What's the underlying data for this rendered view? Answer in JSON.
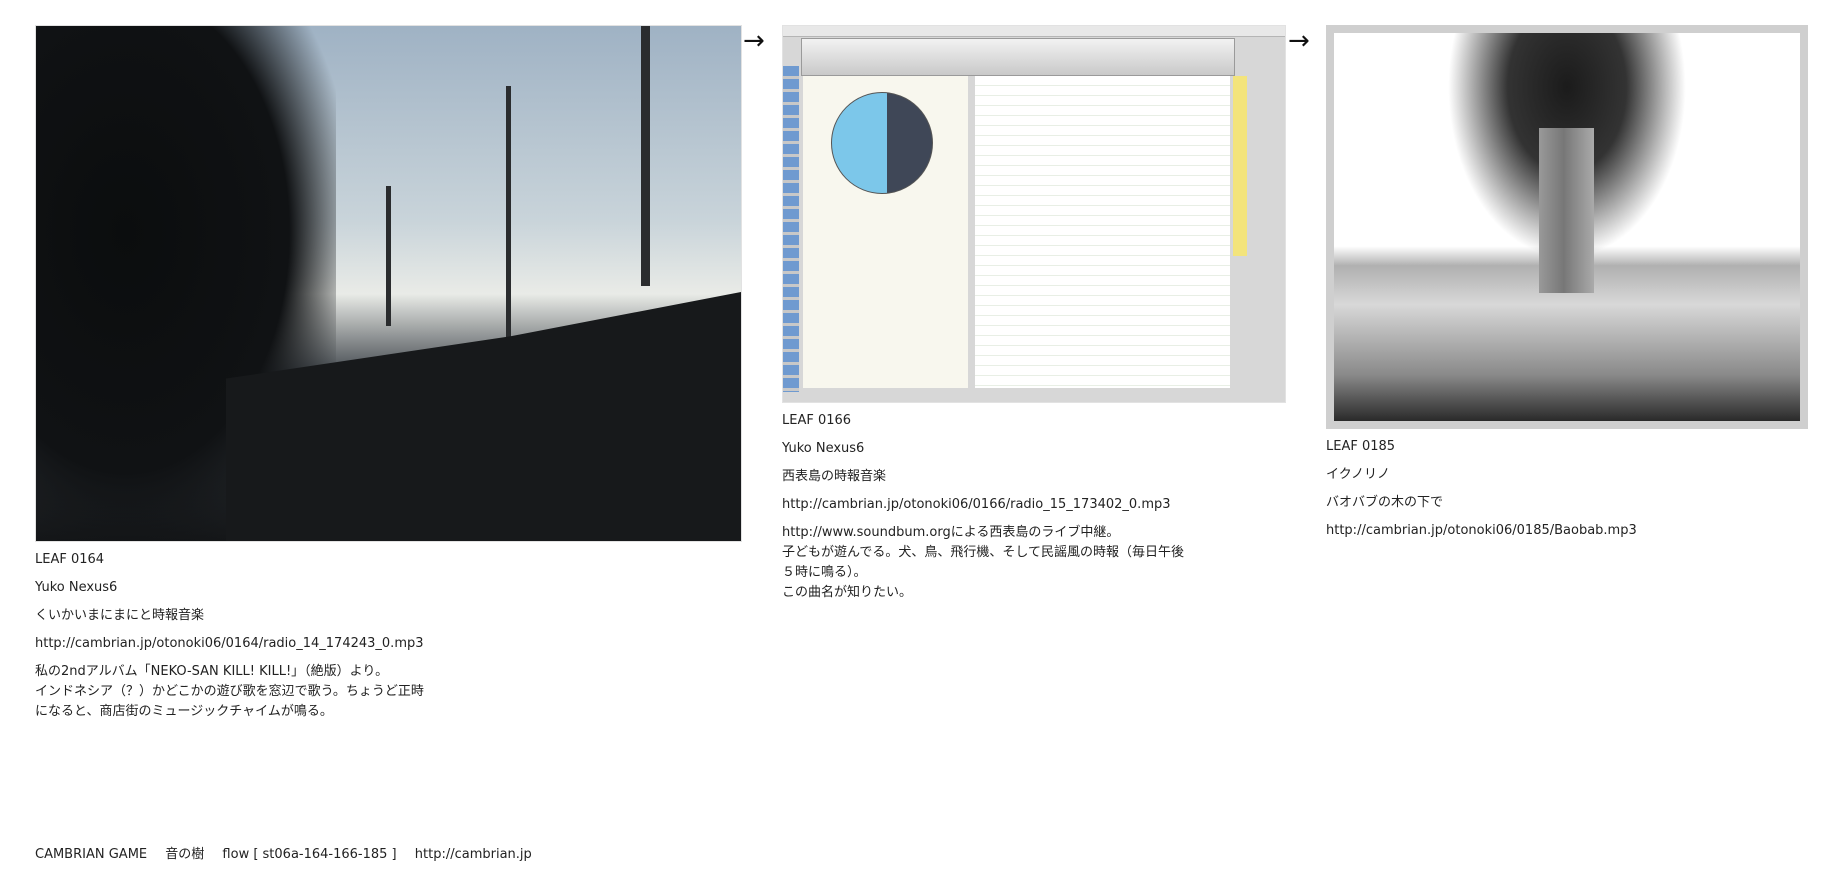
{
  "leaves": [
    {
      "id": "LEAF 0164",
      "artist": "Yuko Nexus6",
      "title": "くいかいまにまにと時報音楽",
      "url": "http://cambrian.jp/otonoki06/0164/radio_14_174243_0.mp3",
      "description": "私の2ndアルバム「NEKO-SAN KILL! KILL!」（絶版）より。\nインドネシア（？）かどこかの遊び歌を窓辺で歌う。ちょうど正時になると、商店街のミュージックチャイムが鳴る。"
    },
    {
      "id": "LEAF 0166",
      "artist": "Yuko Nexus6",
      "title": "西表島の時報音楽",
      "url": "http://cambrian.jp/otonoki06/0166/radio_15_173402_0.mp3",
      "description": "http://www.soundbum.orgによる西表島のライブ中継。\n子どもが遊んでる。犬、鳥、飛行機、そして民謡風の時報（毎日午後５時に鳴る）。\nこの曲名が知りたい。"
    },
    {
      "id": "LEAF 0185",
      "artist": "イクノリノ",
      "title": "バオバブの木の下で",
      "url": "http://cambrian.jp/otonoki06/0185/Baobab.mp3",
      "description": ""
    }
  ],
  "arrows": [
    "→",
    "→"
  ],
  "footer": {
    "game": "CAMBRIAN GAME",
    "project": "音の樹",
    "flow": "flow [ st06a-164-166-185 ]",
    "site": "http://cambrian.jp"
  }
}
